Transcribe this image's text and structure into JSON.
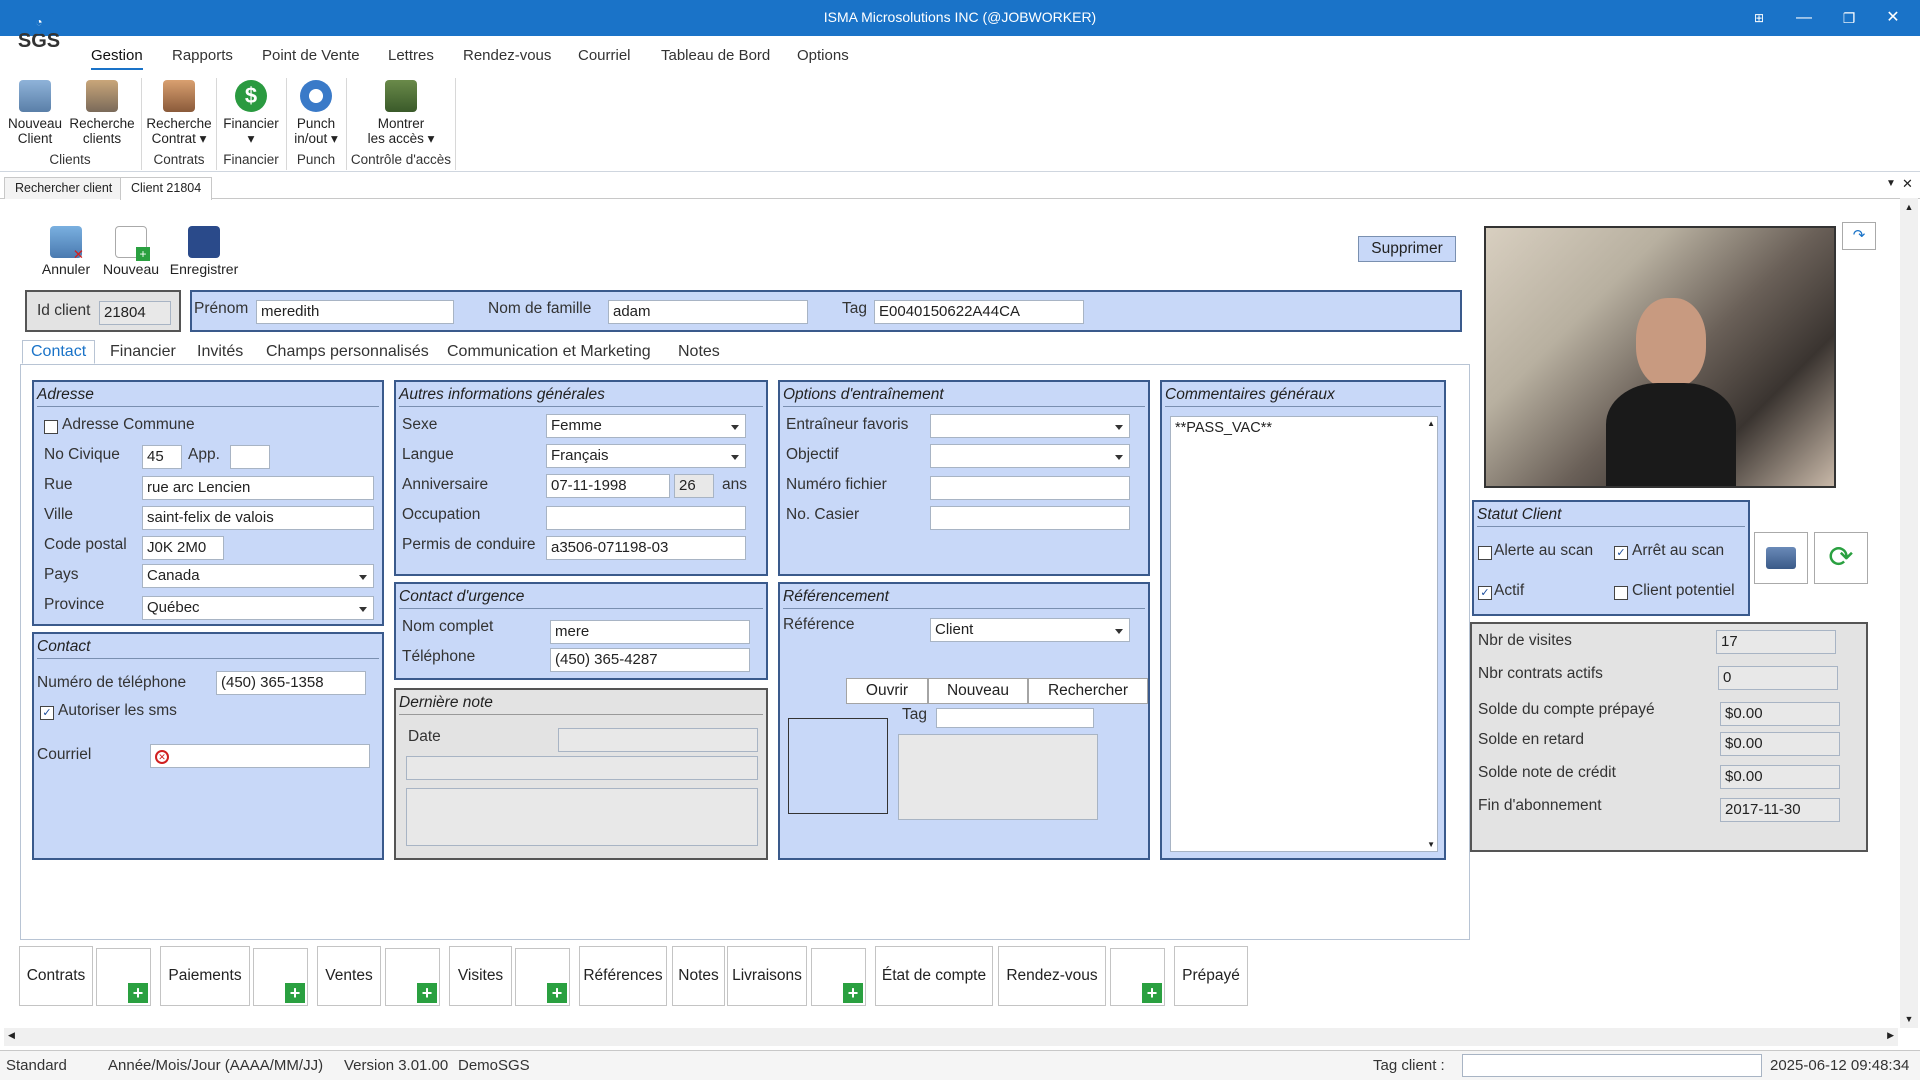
{
  "window": {
    "title": "ISMA Microsolutions INC (@JOBWORKER)"
  },
  "logo": "SGS",
  "menu": [
    "Gestion",
    "Rapports",
    "Point de Vente",
    "Lettres",
    "Rendez-vous",
    "Courriel",
    "Tableau de Bord",
    "Options"
  ],
  "ribbon": {
    "buttons": [
      {
        "l1": "Nouveau",
        "l2": "Client"
      },
      {
        "l1": "Recherche",
        "l2": "clients"
      },
      {
        "l1": "Recherche",
        "l2": "Contrat ▾"
      },
      {
        "l1": "Financier",
        "l2": "▾"
      },
      {
        "l1": "Punch",
        "l2": "in/out ▾"
      },
      {
        "l1": "Montrer",
        "l2": "les accès ▾"
      }
    ],
    "groups": [
      "Clients",
      "Contrats",
      "Financier",
      "Punch",
      "Contrôle d'accès"
    ]
  },
  "doc_tabs": [
    "Rechercher client",
    "Client 21804"
  ],
  "toolbar": {
    "annuler": "Annuler",
    "nouveau": "Nouveau",
    "enregistrer": "Enregistrer",
    "supprimer": "Supprimer"
  },
  "client": {
    "id_label": "Id client",
    "id": "21804",
    "prenom_label": "Prénom",
    "prenom": "meredith",
    "nom_label": "Nom de famille",
    "nom": "adam",
    "tag_label": "Tag",
    "tag": "E0040150622A44CA"
  },
  "subtabs": [
    "Contact",
    "Financier",
    "Invités",
    "Champs personnalisés",
    "Communication et Marketing",
    "Notes"
  ],
  "adresse": {
    "title": "Adresse",
    "commune": "Adresse Commune",
    "no_civique_label": "No Civique",
    "no_civique": "45",
    "app_label": "App.",
    "app": "",
    "rue_label": "Rue",
    "rue": "rue arc Lencien",
    "ville_label": "Ville",
    "ville": "saint-felix de valois",
    "cp_label": "Code postal",
    "cp": "J0K 2M0",
    "pays_label": "Pays",
    "pays": "Canada",
    "province_label": "Province",
    "province": "Québec"
  },
  "contact": {
    "title": "Contact",
    "tel_label": "Numéro de téléphone",
    "tel": "(450) 365-1358",
    "sms": "Autoriser les sms",
    "courriel_label": "Courriel"
  },
  "autres": {
    "title": "Autres informations générales",
    "sexe_label": "Sexe",
    "sexe": "Femme",
    "langue_label": "Langue",
    "langue": "Français",
    "anniv_label": "Anniversaire",
    "anniv": "07-11-1998",
    "age": "26",
    "ans": "ans",
    "occupation_label": "Occupation",
    "occupation": "",
    "permis_label": "Permis de conduire",
    "permis": "a3506-071198-03"
  },
  "urgence": {
    "title": "Contact d'urgence",
    "nom_label": "Nom complet",
    "nom": "mere",
    "tel_label": "Téléphone",
    "tel": "(450) 365-4287"
  },
  "derniere": {
    "title": "Dernière note",
    "date_label": "Date"
  },
  "entrainement": {
    "title": "Options d'entraînement",
    "entraineur_label": "Entraîneur favoris",
    "objectif_label": "Objectif",
    "fichier_label": "Numéro fichier",
    "casier_label": "No. Casier"
  },
  "referencement": {
    "title": "Référencement",
    "ref_label": "Référence",
    "ref": "Client",
    "ouvrir": "Ouvrir",
    "nouveau": "Nouveau",
    "rechercher": "Rechercher",
    "tag_label": "Tag"
  },
  "commentaires": {
    "title": "Commentaires généraux",
    "text": "**PASS_VAC**"
  },
  "statut": {
    "title": "Statut Client",
    "alerte": "Alerte au scan",
    "arret": "Arrêt au scan",
    "actif": "Actif",
    "potentiel": "Client potentiel"
  },
  "stats": [
    {
      "label": "Nbr de visites",
      "value": "17"
    },
    {
      "label": "Nbr contrats actifs",
      "value": "0"
    },
    {
      "label": "Solde du compte prépayé",
      "value": "$0.00"
    },
    {
      "label": "Solde en retard",
      "value": "$0.00"
    },
    {
      "label": "Solde note de crédit",
      "value": "$0.00"
    },
    {
      "label": "Fin d'abonnement",
      "value": "2017-11-30"
    }
  ],
  "bottom": [
    "Contrats",
    "Paiements",
    "Ventes",
    "Visites",
    "Références",
    "Notes",
    "Livraisons",
    "État de compte",
    "Rendez-vous",
    "Prépayé"
  ],
  "status": {
    "mode": "Standard",
    "date_format": "Année/Mois/Jour (AAAA/MM/JJ)",
    "version": "Version 3.01.00",
    "db": "DemoSGS",
    "tag_label": "Tag client :",
    "datetime": "2025-06-12 09:48:34"
  },
  "colors": {
    "title_bar": "#1a73c8",
    "panel": "#c8d8f8",
    "panel_border": "#3a5a8c"
  }
}
